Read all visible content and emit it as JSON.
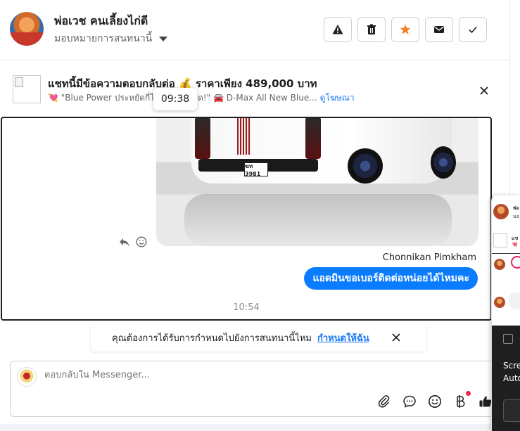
{
  "header": {
    "contact_name": "พ่อเวช คนเลี้ยงไก่ดี",
    "assign_label": "มอบหมายการสนทนานี้",
    "buttons": [
      {
        "icon": "warning-icon"
      },
      {
        "icon": "trash-icon"
      },
      {
        "icon": "star-icon",
        "color": "#f5822a"
      },
      {
        "icon": "mail-icon"
      },
      {
        "icon": "check-icon"
      }
    ]
  },
  "ad": {
    "title": "แชทนี้มีข้อความตอบกลับต่อ 💰 ราคาเพียง 489,000 บาท",
    "subtitle_text": "💘 \"Blue Power ประหยัดกี่ได",
    "subtitle_text2": "ด!\" 🚘 D-Max All New Blue...",
    "link": "ดูโฆษณา"
  },
  "tooltip": {
    "time": "09:38"
  },
  "chat": {
    "plate_text": "ฆท 3981",
    "sender_name": "Chonnikan Pimkham",
    "message": "แอดมินขอเบอร์ติดต่อหน่อยได้ไหมคะ",
    "timestamp": "10:54"
  },
  "reassign": {
    "question": "คุณต้องการได้รับการกำหนดไปยังการสนทนานี้ไหม",
    "link": "กำหนดให้ฉัน"
  },
  "composer": {
    "placeholder": "ตอบกลับใน Messenger..."
  },
  "overlay": {
    "name_snippet": "พ่อ",
    "sub_snippet": "มอ",
    "ad_snippet": "แช",
    "ad_sub_snippet": "💘 ",
    "text_line1": "Scre",
    "text_line2": "Auto"
  },
  "colors": {
    "accent": "#0a7cff",
    "link": "#1877f2",
    "star": "#f5822a"
  }
}
